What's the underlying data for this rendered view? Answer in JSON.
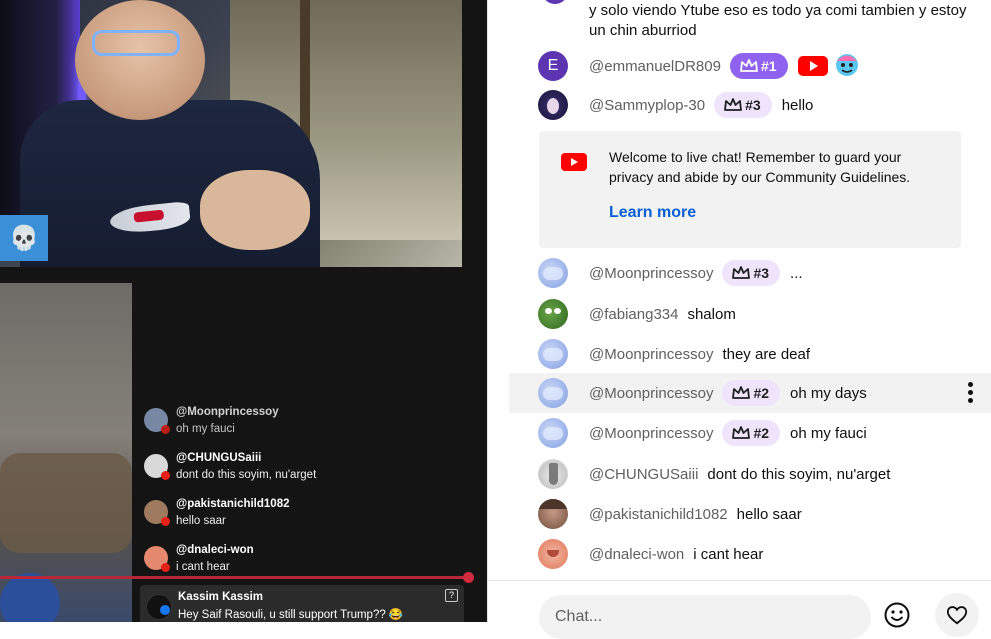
{
  "overlay": {
    "messages": [
      {
        "name": "@Moonprincessoy",
        "text": "oh my fauci"
      },
      {
        "name": "@CHUNGUSaiii",
        "text": "dont do this soyim, nu'arget"
      },
      {
        "name": "@pakistanichild1082",
        "text": "hello saar"
      },
      {
        "name": "@dnaleci-won",
        "text": "i cant hear"
      }
    ],
    "pinned": {
      "name": "Kassim Kassim",
      "text": "Hey Saif Rasouli, u still support Trump?? 😂"
    }
  },
  "chat": {
    "top_message": "y solo viendo Ytube eso es todo ya comi tambien y estoy un chin aburriod",
    "rows": [
      {
        "avatar_letter": "E",
        "author": "@emmanuelDR809",
        "badge": "#1",
        "message": "",
        "accent": "#8f62f0"
      },
      {
        "author": "@Sammyplop-30",
        "badge": "#3",
        "message": "hello"
      },
      {
        "author": "@Moonprincessoy",
        "badge": "#3",
        "message": "..."
      },
      {
        "author": "@fabiang334",
        "badge": "",
        "message": "shalom"
      },
      {
        "author": "@Moonprincessoy",
        "badge": "",
        "message": "they are deaf"
      },
      {
        "author": "@Moonprincessoy",
        "badge": "#2",
        "message": "oh my days"
      },
      {
        "author": "@Moonprincessoy",
        "badge": "#2",
        "message": "oh my fauci"
      },
      {
        "author": "@CHUNGUSaiii",
        "badge": "",
        "message": "dont do this soyim, nu'arget"
      },
      {
        "author": "@pakistanichild1082",
        "badge": "",
        "message": "hello saar"
      },
      {
        "author": "@dnaleci-won",
        "badge": "",
        "message": "i cant hear"
      }
    ],
    "welcome": {
      "text": "Welcome to live chat! Remember to guard your privacy and abide by our Community Guidelines.",
      "link": "Learn more"
    },
    "input": {
      "placeholder": "Chat..."
    }
  },
  "icons": {
    "skull": "skull-icon",
    "youtube": "youtube-icon",
    "crown": "crown-icon",
    "emoji": "emoji-icon",
    "heart": "heart-icon",
    "more": "more-vert-icon"
  },
  "colors": {
    "link": "#065fd4",
    "badge_purple": "#8f62f0",
    "badge_light": "#efe4fb",
    "youtube_red": "#ff0000"
  }
}
